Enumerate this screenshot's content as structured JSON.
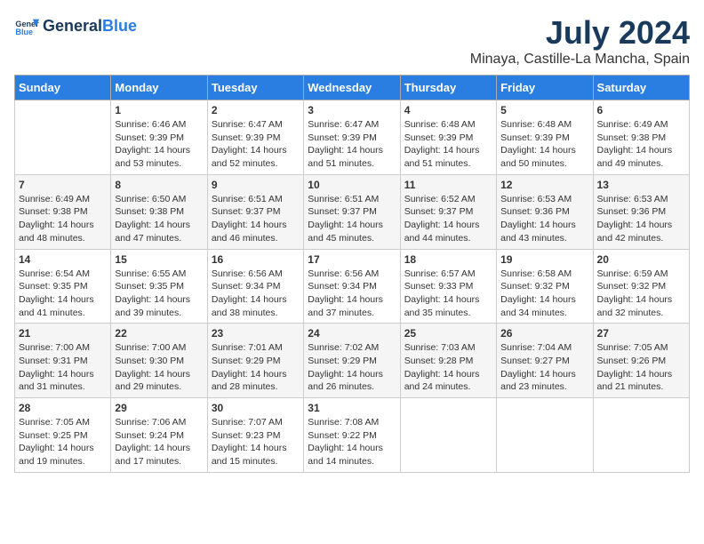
{
  "header": {
    "logo_general": "General",
    "logo_blue": "Blue",
    "month": "July 2024",
    "location": "Minaya, Castille-La Mancha, Spain"
  },
  "days_of_week": [
    "Sunday",
    "Monday",
    "Tuesday",
    "Wednesday",
    "Thursday",
    "Friday",
    "Saturday"
  ],
  "weeks": [
    [
      {
        "day": "",
        "content": ""
      },
      {
        "day": "1",
        "content": "Sunrise: 6:46 AM\nSunset: 9:39 PM\nDaylight: 14 hours\nand 53 minutes."
      },
      {
        "day": "2",
        "content": "Sunrise: 6:47 AM\nSunset: 9:39 PM\nDaylight: 14 hours\nand 52 minutes."
      },
      {
        "day": "3",
        "content": "Sunrise: 6:47 AM\nSunset: 9:39 PM\nDaylight: 14 hours\nand 51 minutes."
      },
      {
        "day": "4",
        "content": "Sunrise: 6:48 AM\nSunset: 9:39 PM\nDaylight: 14 hours\nand 51 minutes."
      },
      {
        "day": "5",
        "content": "Sunrise: 6:48 AM\nSunset: 9:39 PM\nDaylight: 14 hours\nand 50 minutes."
      },
      {
        "day": "6",
        "content": "Sunrise: 6:49 AM\nSunset: 9:38 PM\nDaylight: 14 hours\nand 49 minutes."
      }
    ],
    [
      {
        "day": "7",
        "content": "Sunrise: 6:49 AM\nSunset: 9:38 PM\nDaylight: 14 hours\nand 48 minutes."
      },
      {
        "day": "8",
        "content": "Sunrise: 6:50 AM\nSunset: 9:38 PM\nDaylight: 14 hours\nand 47 minutes."
      },
      {
        "day": "9",
        "content": "Sunrise: 6:51 AM\nSunset: 9:37 PM\nDaylight: 14 hours\nand 46 minutes."
      },
      {
        "day": "10",
        "content": "Sunrise: 6:51 AM\nSunset: 9:37 PM\nDaylight: 14 hours\nand 45 minutes."
      },
      {
        "day": "11",
        "content": "Sunrise: 6:52 AM\nSunset: 9:37 PM\nDaylight: 14 hours\nand 44 minutes."
      },
      {
        "day": "12",
        "content": "Sunrise: 6:53 AM\nSunset: 9:36 PM\nDaylight: 14 hours\nand 43 minutes."
      },
      {
        "day": "13",
        "content": "Sunrise: 6:53 AM\nSunset: 9:36 PM\nDaylight: 14 hours\nand 42 minutes."
      }
    ],
    [
      {
        "day": "14",
        "content": "Sunrise: 6:54 AM\nSunset: 9:35 PM\nDaylight: 14 hours\nand 41 minutes."
      },
      {
        "day": "15",
        "content": "Sunrise: 6:55 AM\nSunset: 9:35 PM\nDaylight: 14 hours\nand 39 minutes."
      },
      {
        "day": "16",
        "content": "Sunrise: 6:56 AM\nSunset: 9:34 PM\nDaylight: 14 hours\nand 38 minutes."
      },
      {
        "day": "17",
        "content": "Sunrise: 6:56 AM\nSunset: 9:34 PM\nDaylight: 14 hours\nand 37 minutes."
      },
      {
        "day": "18",
        "content": "Sunrise: 6:57 AM\nSunset: 9:33 PM\nDaylight: 14 hours\nand 35 minutes."
      },
      {
        "day": "19",
        "content": "Sunrise: 6:58 AM\nSunset: 9:32 PM\nDaylight: 14 hours\nand 34 minutes."
      },
      {
        "day": "20",
        "content": "Sunrise: 6:59 AM\nSunset: 9:32 PM\nDaylight: 14 hours\nand 32 minutes."
      }
    ],
    [
      {
        "day": "21",
        "content": "Sunrise: 7:00 AM\nSunset: 9:31 PM\nDaylight: 14 hours\nand 31 minutes."
      },
      {
        "day": "22",
        "content": "Sunrise: 7:00 AM\nSunset: 9:30 PM\nDaylight: 14 hours\nand 29 minutes."
      },
      {
        "day": "23",
        "content": "Sunrise: 7:01 AM\nSunset: 9:29 PM\nDaylight: 14 hours\nand 28 minutes."
      },
      {
        "day": "24",
        "content": "Sunrise: 7:02 AM\nSunset: 9:29 PM\nDaylight: 14 hours\nand 26 minutes."
      },
      {
        "day": "25",
        "content": "Sunrise: 7:03 AM\nSunset: 9:28 PM\nDaylight: 14 hours\nand 24 minutes."
      },
      {
        "day": "26",
        "content": "Sunrise: 7:04 AM\nSunset: 9:27 PM\nDaylight: 14 hours\nand 23 minutes."
      },
      {
        "day": "27",
        "content": "Sunrise: 7:05 AM\nSunset: 9:26 PM\nDaylight: 14 hours\nand 21 minutes."
      }
    ],
    [
      {
        "day": "28",
        "content": "Sunrise: 7:05 AM\nSunset: 9:25 PM\nDaylight: 14 hours\nand 19 minutes."
      },
      {
        "day": "29",
        "content": "Sunrise: 7:06 AM\nSunset: 9:24 PM\nDaylight: 14 hours\nand 17 minutes."
      },
      {
        "day": "30",
        "content": "Sunrise: 7:07 AM\nSunset: 9:23 PM\nDaylight: 14 hours\nand 15 minutes."
      },
      {
        "day": "31",
        "content": "Sunrise: 7:08 AM\nSunset: 9:22 PM\nDaylight: 14 hours\nand 14 minutes."
      },
      {
        "day": "",
        "content": ""
      },
      {
        "day": "",
        "content": ""
      },
      {
        "day": "",
        "content": ""
      }
    ]
  ]
}
